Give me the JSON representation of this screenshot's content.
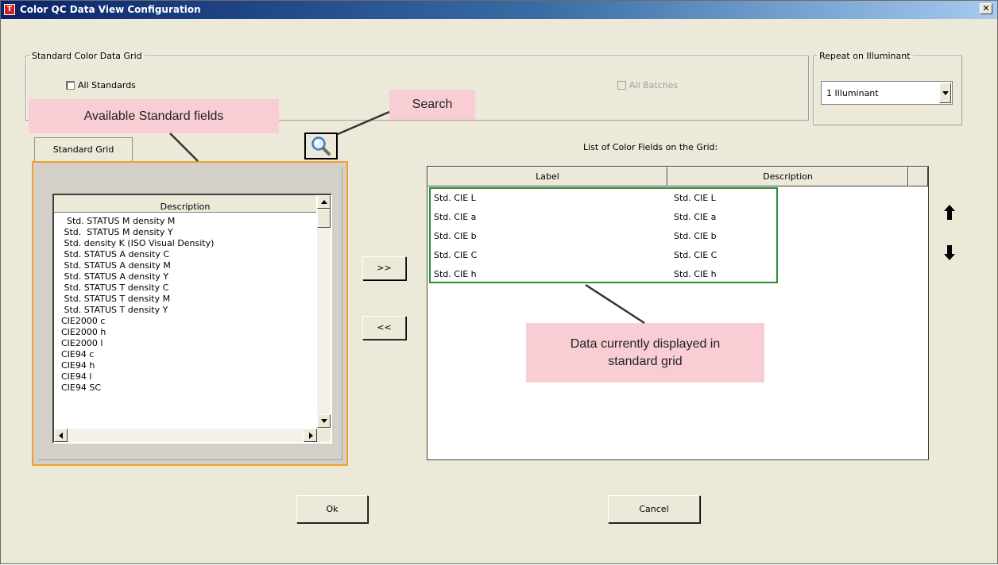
{
  "window": {
    "title": "Color QC Data View Configuration",
    "app_icon_glyph": "T",
    "close_glyph": "✕"
  },
  "standard_group": {
    "legend": "Standard Color Data Grid",
    "all_standards_label": "All Standards",
    "all_batches_label": "All Batches"
  },
  "repeat_group": {
    "legend": "Repeat on Illuminant",
    "selected": "1 Illuminant"
  },
  "tab": {
    "label": "Standard Grid"
  },
  "available_list": {
    "header": "Description",
    "items": [
      "  Std. STATUS M density M",
      " Std.  STATUS M density Y",
      " Std. density K (ISO Visual Density)",
      " Std. STATUS A density C",
      " Std. STATUS A density M",
      " Std. STATUS A density Y",
      " Std. STATUS T density C",
      " Std. STATUS T density M",
      " Std. STATUS T density Y",
      "CIE2000 c",
      "CIE2000 h",
      "CIE2000 l",
      "CIE94 c",
      "CIE94 h",
      "CIE94 l",
      "CIE94 SC"
    ]
  },
  "buttons": {
    "add": ">>",
    "remove": "<<",
    "ok": "Ok",
    "cancel": "Cancel"
  },
  "color_grid": {
    "caption": "List of Color Fields on the Grid:",
    "columns": [
      "Label",
      "Description"
    ],
    "rows": [
      {
        "label": "Std. CIE L",
        "description": "Std. CIE L"
      },
      {
        "label": "Std. CIE a",
        "description": "Std. CIE a"
      },
      {
        "label": "Std. CIE b",
        "description": "Std. CIE b"
      },
      {
        "label": "Std. CIE C",
        "description": "Std. CIE C"
      },
      {
        "label": "Std. CIE h",
        "description": "Std. CIE h"
      }
    ]
  },
  "icons": {
    "search": "magnifier-icon",
    "move_up": "arrow-up-icon",
    "move_down": "arrow-down-icon"
  },
  "callouts": {
    "standard_fields": "Available Standard fields",
    "search": "Search",
    "data_displayed": "Data currently displayed in standard grid"
  },
  "colors": {
    "highlight_orange": "#f0a030",
    "highlight_green": "#2e8b2e",
    "callout_pink": "#f8cdd3",
    "title_gradient_start": "#0a246a"
  }
}
